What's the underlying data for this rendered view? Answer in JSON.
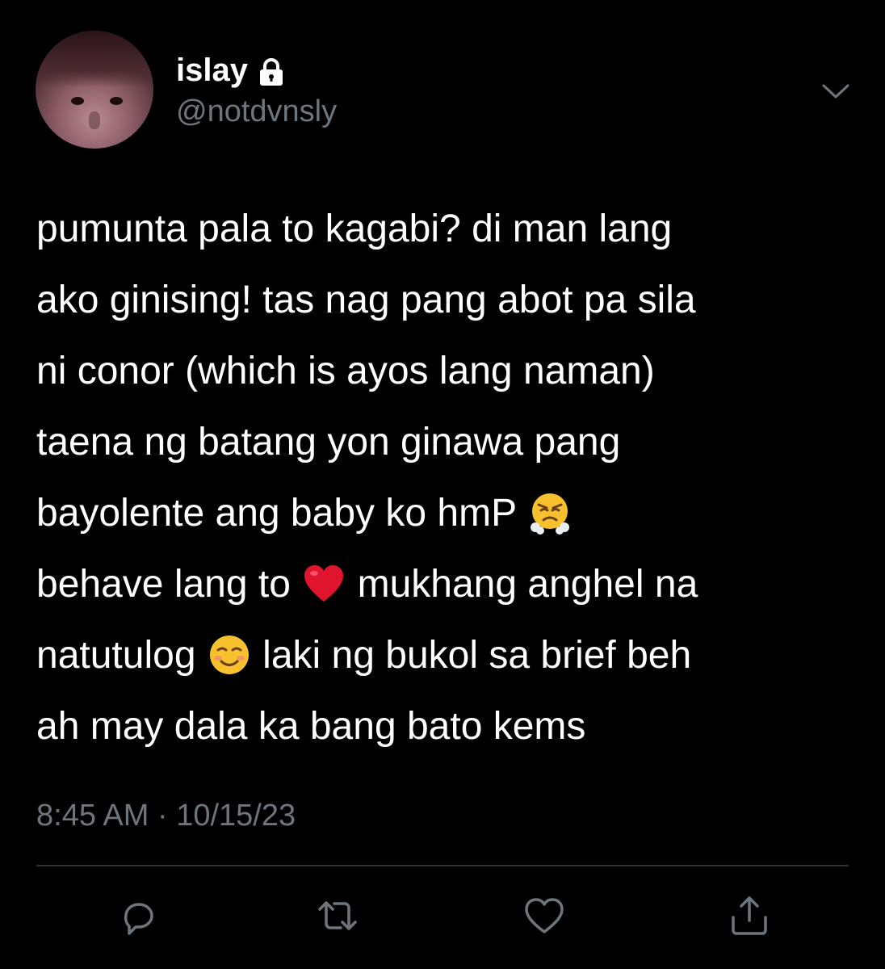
{
  "user": {
    "display_name": "islay",
    "handle": "@notdvnsly",
    "protected_icon": "lock-icon",
    "avatar_icon": "avatar"
  },
  "tweet": {
    "lines": [
      "pumunta pala to kagabi? di man lang",
      "ako ginising! tas nag pang abot pa sila",
      "ni conor (which is ayos lang naman)",
      "taena ng batang yon ginawa pang"
    ],
    "line5_before": "bayolente ang baby ko hmP ",
    "line6_before": "behave lang to ",
    "line6_after": " mukhang anghel na",
    "line7_before": "natutulog ",
    "line7_after": " laki ng bukol sa brief beh",
    "line8": "ah may dala ka bang bato kems",
    "emojis": [
      "huffing-face-emoji",
      "red-heart-emoji",
      "smiling-face-emoji"
    ],
    "time": "8:45 AM",
    "separator": " · ",
    "date": "10/15/23"
  },
  "actions": [
    "reply-icon",
    "retweet-icon",
    "like-icon",
    "share-icon"
  ],
  "colors": {
    "background": "#000000",
    "text": "#ffffff",
    "secondary_text": "#6e767d",
    "divider": "#2f3336",
    "heart": "#e0142d",
    "emoji_yellow": "#f7c12e"
  }
}
